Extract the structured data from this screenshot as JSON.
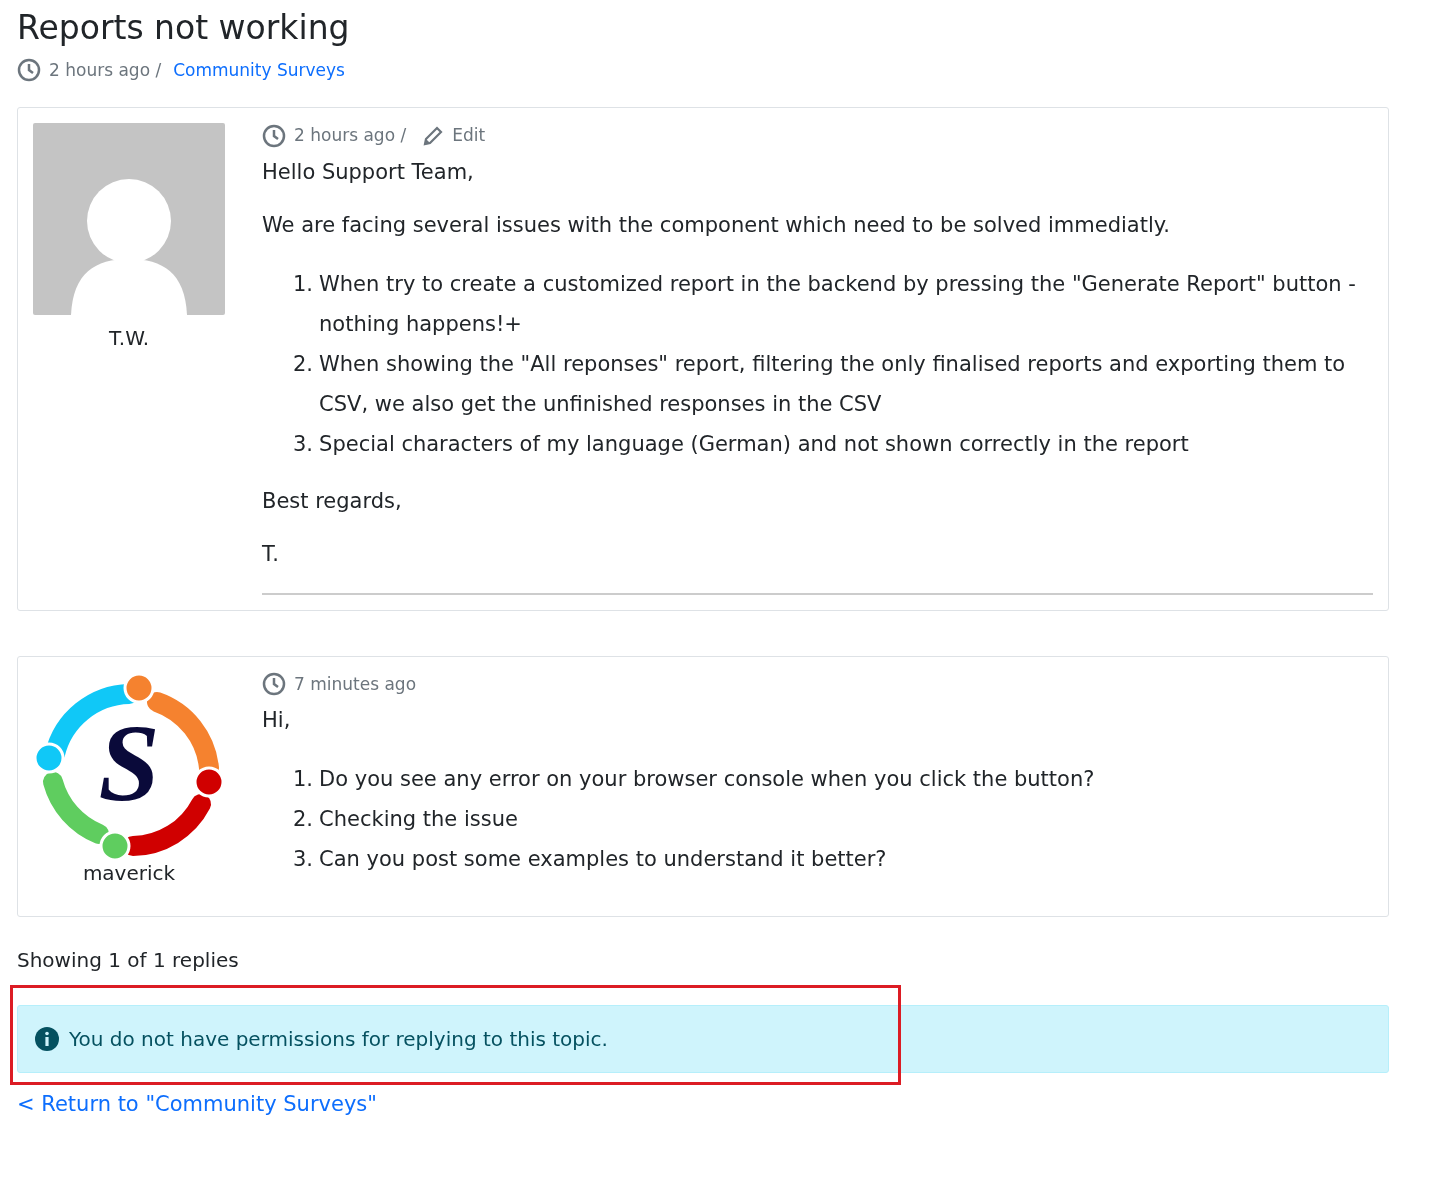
{
  "topic": {
    "title": "Reports not working",
    "time": "2 hours ago /",
    "forum_link": "Community Surveys"
  },
  "posts": [
    {
      "author": "T.W.",
      "avatar": {
        "kind": "silhouette"
      },
      "time": "2 hours ago /",
      "edit_label": "Edit",
      "greeting": "Hello Support Team,",
      "paragraphs_before": [
        "We are facing several issues with the component which need to be solved immediatly."
      ],
      "list": [
        {
          "number": "1.",
          "text": "When try to create a customized report in the backend by pressing the \"Generate Report\" button - nothing happens!+"
        },
        {
          "number": "2.",
          "text": "When showing the \"All reponses\" report, filtering the only finalised reports and exporting them to CSV, we also get the unfinished responses in the CSV"
        },
        {
          "number": "3.",
          "text": "Special characters of my language (German) and not shown correctly in the report"
        }
      ],
      "paragraphs_after": [
        "Best regards,",
        "T."
      ],
      "signature_divider": true
    },
    {
      "author": "maverick",
      "avatar": {
        "kind": "logo",
        "letter": "S"
      },
      "time": "7 minutes ago",
      "greeting": "Hi,",
      "list": [
        {
          "number": "1.",
          "text": "Do you see any error on your browser console when you click the button?"
        },
        {
          "number": "2.",
          "text": "Checking the issue"
        },
        {
          "number": "3.",
          "text": "Can you post some examples to understand it better?"
        }
      ],
      "signature_divider": false
    }
  ],
  "replies_count": "Showing 1 of 1 replies",
  "alert": {
    "text": "You do not have permissions for replying to this topic.",
    "highlighted": true
  },
  "return_link": "< Return to \"Community Surveys\""
}
